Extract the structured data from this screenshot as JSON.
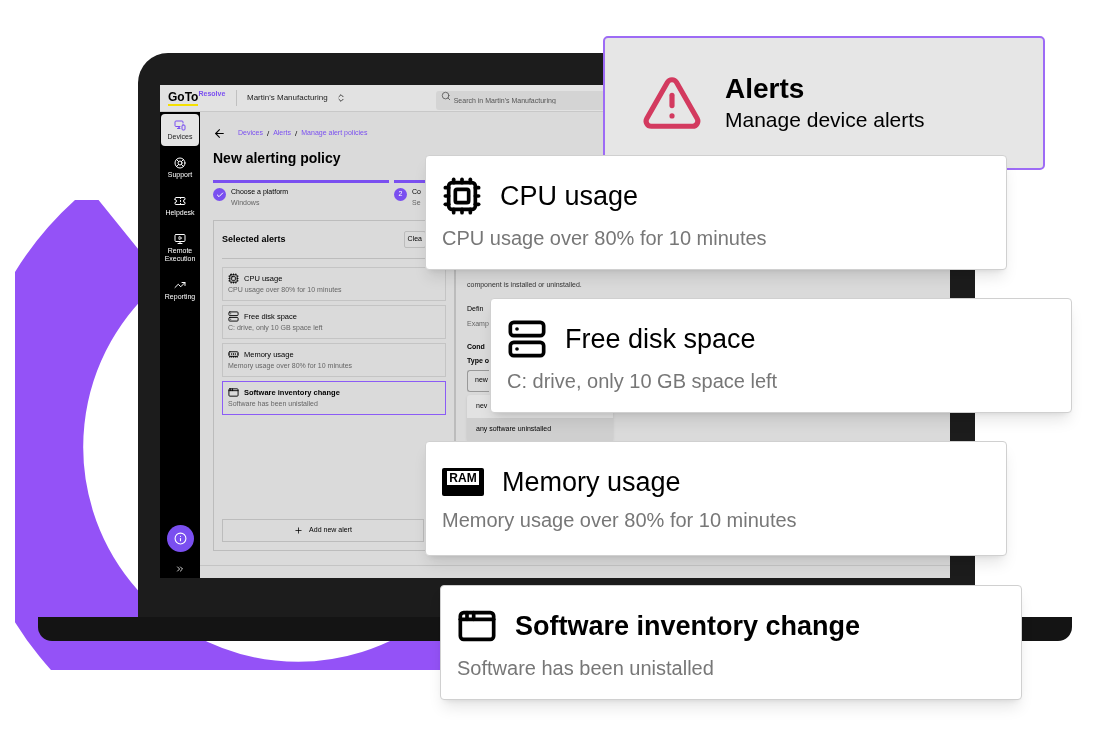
{
  "app": {
    "brand": "GoTo",
    "brand_product": "Resolve",
    "workspace": "Martin's Manufacturing",
    "search": {
      "placeholder": "Search in Martin's Manufacturing"
    }
  },
  "nav": [
    {
      "label": "Devices",
      "selected": true,
      "kind": "devices"
    },
    {
      "label": "Support",
      "selected": false,
      "kind": "support"
    },
    {
      "label": "Helpdesk",
      "selected": false,
      "kind": "helpdesk"
    },
    {
      "label": "Remote Execution",
      "selected": false,
      "kind": "remote"
    },
    {
      "label": "Reporting",
      "selected": false,
      "kind": "reporting"
    }
  ],
  "breadcrumb": [
    {
      "kind": "link",
      "text": "Devices"
    },
    {
      "kind": "separator",
      "text": "/"
    },
    {
      "kind": "link",
      "text": "Alerts"
    },
    {
      "kind": "separator",
      "text": "/"
    },
    {
      "kind": "link",
      "text": "Manage alert policies"
    }
  ],
  "page_title": "New alerting policy",
  "steps": [
    {
      "title": "Choose a platform",
      "subtitle": "Windows",
      "completed": true
    },
    {
      "number": "2",
      "title": "Co",
      "subtitle": "Se",
      "completed": false
    }
  ],
  "selected_alerts": {
    "title": "Selected alerts",
    "clear_button": "Clea",
    "add_button": "Add new alert",
    "items": [
      {
        "kind": "cpu",
        "title": "CPU usage",
        "description": "CPU usage over 80% for 10 minutes",
        "selected": false
      },
      {
        "kind": "disk",
        "title": "Free disk space",
        "description": "C: drive, only 10 GB space left",
        "selected": false
      },
      {
        "kind": "memory",
        "title": "Memory usage",
        "description": "Memory usage over 80% for 10 minutes",
        "selected": false
      },
      {
        "kind": "software",
        "title": "Software inventory change",
        "description": "Software has been unistalled",
        "selected": true
      }
    ]
  },
  "details": {
    "description": "component is installed or uninstalled.",
    "define_label": "Defin",
    "example_hint": "Examp",
    "conditions_label": "Cond",
    "type_label": "Type o",
    "type_value": "new",
    "options": [
      {
        "label": "nev",
        "selected": false
      },
      {
        "label": "any software uninstalled",
        "selected": true
      }
    ]
  },
  "header_card": {
    "title": "Alerts",
    "subtitle": "Manage device alerts"
  },
  "alert_cards": [
    {
      "kind": "cpu",
      "title": "CPU usage",
      "description": "CPU usage over 80% for 10 minutes"
    },
    {
      "kind": "disk",
      "title": "Free disk space",
      "description": "C: drive, only 10 GB space left"
    },
    {
      "kind": "memory",
      "title": "Memory usage",
      "description": "Memory usage over 80% for 10 minutes",
      "icon_label": "RAM"
    },
    {
      "kind": "software",
      "title": "Software inventory change",
      "description": "Software has been unistalled"
    }
  ]
}
